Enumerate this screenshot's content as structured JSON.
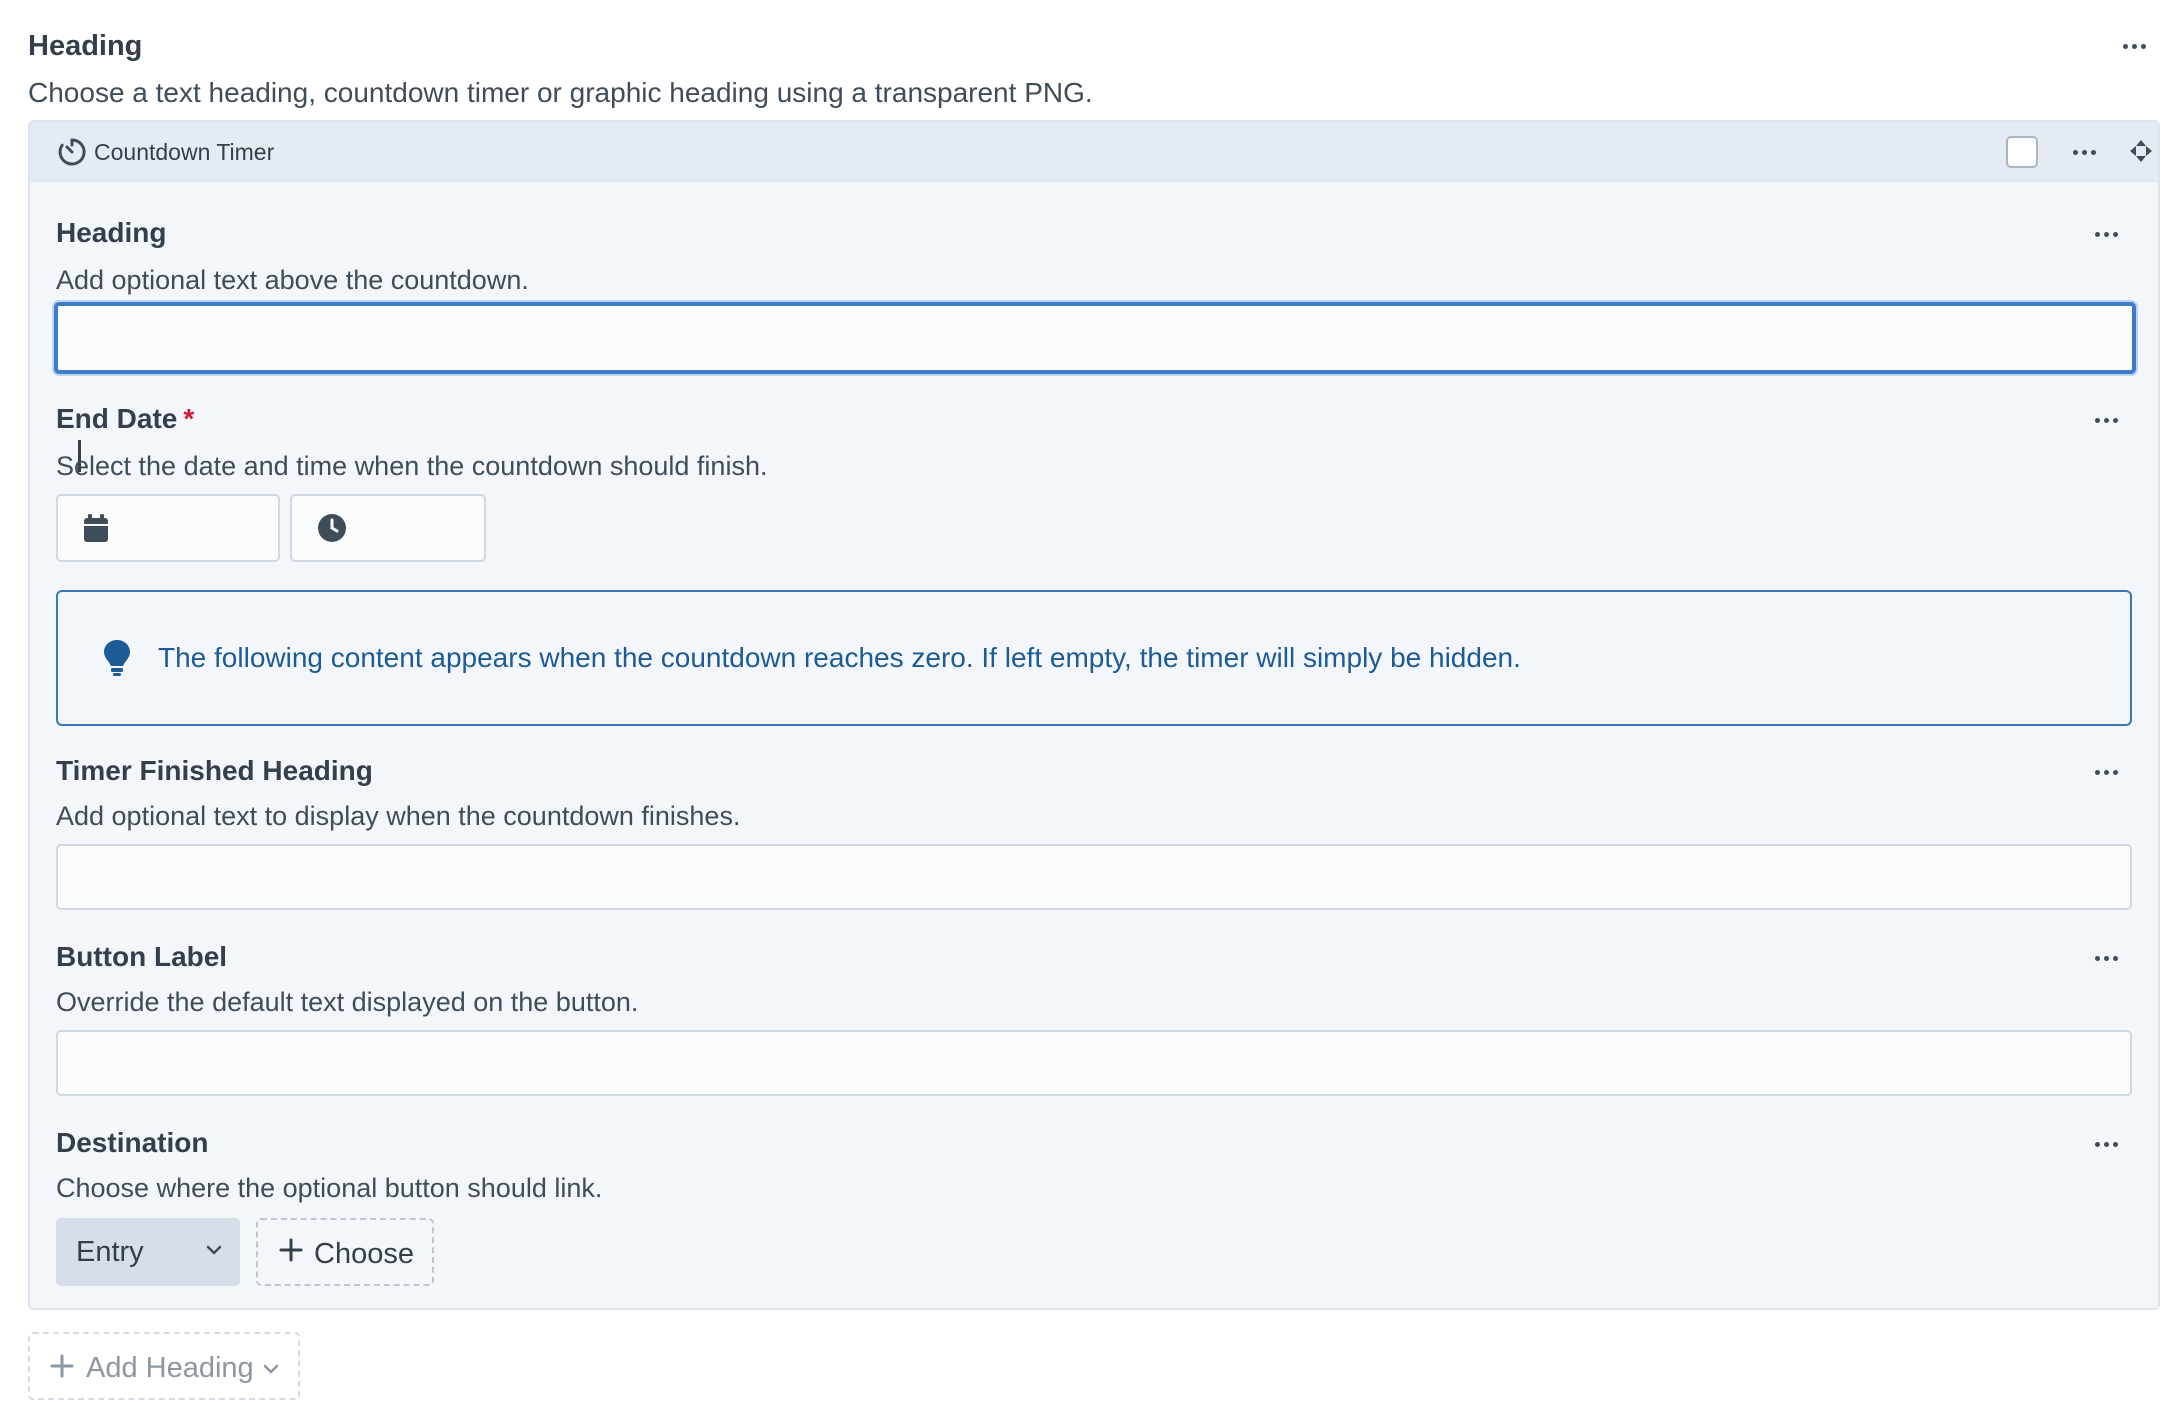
{
  "outer_field": {
    "label": "Heading",
    "instructions": "Choose a text heading, countdown timer or graphic heading using a transparent PNG."
  },
  "block": {
    "type_label": "Countdown Timer",
    "fields": {
      "heading": {
        "label": "Heading",
        "instructions": "Add optional text above the countdown.",
        "value": ""
      },
      "end_date": {
        "label": "End Date",
        "required_mark": "*",
        "instructions": "Select the date and time when the countdown should finish.",
        "date_value": "",
        "time_value": ""
      },
      "notice": {
        "text": "The following content appears when the countdown reaches zero. If left empty, the timer will simply be hidden.",
        "icon": "lightbulb-icon"
      },
      "timer_finished_heading": {
        "label": "Timer Finished Heading",
        "instructions": "Add optional text to display when the countdown finishes.",
        "value": ""
      },
      "button_label": {
        "label": "Button Label",
        "instructions": "Override the default text displayed on the button.",
        "value": ""
      },
      "destination": {
        "label": "Destination",
        "instructions": "Choose where the optional button should link.",
        "type_selected": "Entry",
        "choose_label": "Choose"
      }
    }
  },
  "add_button": {
    "label": "Add Heading"
  },
  "colors": {
    "accent_focus": "#3e7cca",
    "notice_border": "#3a77b6",
    "notice_text": "#1d5a96",
    "required": "#d0183a",
    "block_bg": "#f3f7fc",
    "block_header_bg": "#e5ebf2"
  },
  "icons": [
    "timer-icon",
    "ellipsis-icon",
    "move-icon",
    "calendar-icon",
    "clock-icon",
    "lightbulb-icon",
    "chevron-down-icon",
    "plus-icon"
  ]
}
